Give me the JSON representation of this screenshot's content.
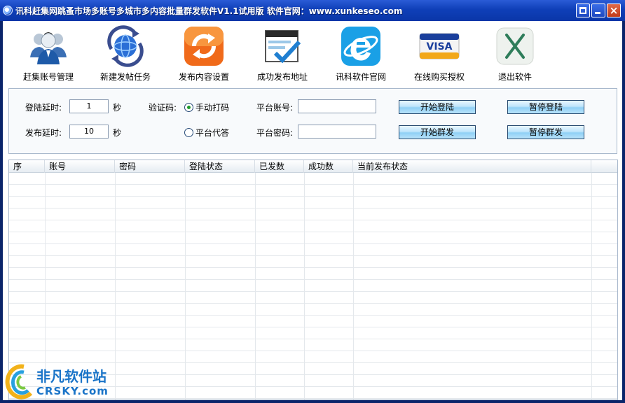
{
  "window": {
    "title": "讯科赶集网跳蚤市场多账号多城市多内容批量群发软件V1.1试用版 软件官网：www.xunkeseo.com"
  },
  "toolbar": [
    {
      "label": "赶集账号管理",
      "icon": "users-icon"
    },
    {
      "label": "新建发帖任务",
      "icon": "globe-refresh-icon"
    },
    {
      "label": "发布内容设置",
      "icon": "sync-icon"
    },
    {
      "label": "成功发布地址",
      "icon": "browser-check-icon"
    },
    {
      "label": "讯科软件官网",
      "icon": "ie-browser-icon"
    },
    {
      "label": "在线购买授权",
      "icon": "visa-card-icon"
    },
    {
      "label": "退出软件",
      "icon": "x-icon"
    }
  ],
  "settings": {
    "login_delay_label": "登陆延时:",
    "login_delay_value": "1",
    "login_delay_unit": "秒",
    "publish_delay_label": "发布延时:",
    "publish_delay_value": "10",
    "publish_delay_unit": "秒",
    "captcha_label": "验证码:",
    "captcha_manual": "手动打码",
    "captcha_platform": "平台代答",
    "captcha_selected": "手动打码",
    "platform_account_label": "平台账号:",
    "platform_account_value": "",
    "platform_password_label": "平台密码:",
    "platform_password_value": "",
    "btn_start_login": "开始登陆",
    "btn_pause_login": "暂停登陆",
    "btn_start_send": "开始群发",
    "btn_pause_send": "暂停群发"
  },
  "table": {
    "columns": [
      "序",
      "账号",
      "密码",
      "登陆状态",
      "已发数",
      "成功数",
      "当前发布状态"
    ],
    "rows": []
  },
  "watermark": {
    "cn": "非凡软件站",
    "en": "CRSKY.com"
  },
  "colors": {
    "title_bar": "#0a36a8",
    "button_face": "#bfe4fb",
    "brand_blue": "#1a74c8"
  }
}
